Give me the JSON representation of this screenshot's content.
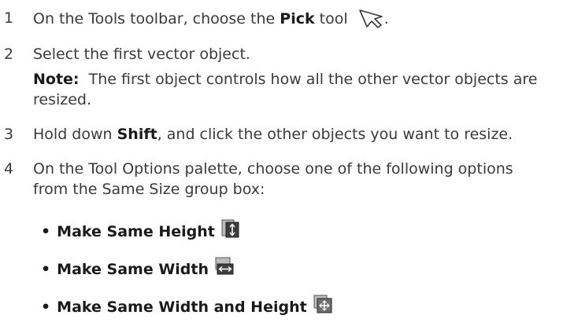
{
  "steps": [
    {
      "number": "1",
      "prefix": "On the Tools toolbar, choose the ",
      "bold": "Pick",
      "suffix": " tool",
      "trailing": ".",
      "icon": "pick-tool-arrow-icon"
    },
    {
      "number": "2",
      "text": "Select the first vector object.",
      "note_label": "Note:",
      "note_line1": "The first object controls how all the other vector objects are",
      "note_line2": "resized."
    },
    {
      "number": "3",
      "prefix": "Hold down ",
      "bold": "Shift",
      "suffix": ", and click the other objects you want to resize."
    },
    {
      "number": "4",
      "line1": "On the Tool Options palette, choose one of the following options",
      "line2": "from the Same Size group box:"
    }
  ],
  "options": [
    {
      "bullet": "•",
      "label": "Make Same Height",
      "icon": "make-same-height-icon"
    },
    {
      "bullet": "•",
      "label": "Make Same Width",
      "icon": "make-same-width-icon"
    },
    {
      "bullet": "•",
      "label": "Make Same Width and Height",
      "icon": "make-same-width-height-icon"
    }
  ]
}
